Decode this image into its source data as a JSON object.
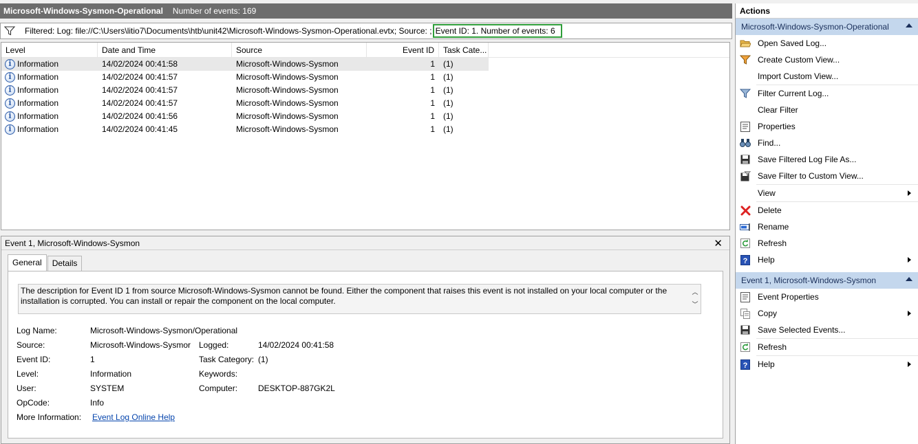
{
  "title_bar": {
    "log_name": "Microsoft-Windows-Sysmon-Operational",
    "event_count": "Number of events: 169"
  },
  "filter_bar": {
    "prefix": "Filtered: Log: file://C:\\Users\\litio7\\Documents\\htb\\unit42\\Microsoft-Windows-Sysmon-Operational.evtx; Source: ;",
    "highlight": "Event ID: 1. Number of events: 6"
  },
  "grid": {
    "columns": [
      "Level",
      "Date and Time",
      "Source",
      "Event ID",
      "Task Cate..."
    ],
    "rows": [
      {
        "level": "Information",
        "date": "14/02/2024 00:41:58",
        "source": "Microsoft-Windows-Sysmon",
        "event_id": "1",
        "task": "(1)"
      },
      {
        "level": "Information",
        "date": "14/02/2024 00:41:57",
        "source": "Microsoft-Windows-Sysmon",
        "event_id": "1",
        "task": "(1)"
      },
      {
        "level": "Information",
        "date": "14/02/2024 00:41:57",
        "source": "Microsoft-Windows-Sysmon",
        "event_id": "1",
        "task": "(1)"
      },
      {
        "level": "Information",
        "date": "14/02/2024 00:41:57",
        "source": "Microsoft-Windows-Sysmon",
        "event_id": "1",
        "task": "(1)"
      },
      {
        "level": "Information",
        "date": "14/02/2024 00:41:56",
        "source": "Microsoft-Windows-Sysmon",
        "event_id": "1",
        "task": "(1)"
      },
      {
        "level": "Information",
        "date": "14/02/2024 00:41:45",
        "source": "Microsoft-Windows-Sysmon",
        "event_id": "1",
        "task": "(1)"
      }
    ]
  },
  "detail": {
    "header": "Event 1, Microsoft-Windows-Sysmon",
    "tabs": [
      "General",
      "Details"
    ],
    "description": "The description for Event ID 1 from source Microsoft-Windows-Sysmon cannot be found. Either the component that raises this event is not installed on your local computer or the installation is corrupted. You can install or repair the component on the local computer.",
    "fields": {
      "log_name_label": "Log Name:",
      "log_name": "Microsoft-Windows-Sysmon/Operational",
      "source_label": "Source:",
      "source": "Microsoft-Windows-Sysmor",
      "logged_label": "Logged:",
      "logged": "14/02/2024 00:41:58",
      "event_id_label": "Event ID:",
      "event_id": "1",
      "task_category_label": "Task Category:",
      "task_category": "(1)",
      "level_label": "Level:",
      "level": "Information",
      "keywords_label": "Keywords:",
      "keywords": "",
      "user_label": "User:",
      "user": "SYSTEM",
      "computer_label": "Computer:",
      "computer": "DESKTOP-887GK2L",
      "opcode_label": "OpCode:",
      "opcode": "Info",
      "more_info_label": "More Information:",
      "more_info_link": "Event Log Online Help"
    }
  },
  "actions": {
    "title": "Actions",
    "section1": {
      "header": "Microsoft-Windows-Sysmon-Operational",
      "items": [
        {
          "label": "Open Saved Log...",
          "icon": "folder-open-icon"
        },
        {
          "label": "Create Custom View...",
          "icon": "filter-star-icon"
        },
        {
          "label": "Import Custom View...",
          "icon": ""
        },
        {
          "label": "Filter Current Log...",
          "icon": "filter-icon"
        },
        {
          "label": "Clear Filter",
          "icon": ""
        },
        {
          "label": "Properties",
          "icon": "properties-icon"
        },
        {
          "label": "Find...",
          "icon": "binoculars-icon"
        },
        {
          "label": "Save Filtered Log File As...",
          "icon": "save-icon"
        },
        {
          "label": "Save Filter to Custom View...",
          "icon": "save-filter-icon"
        },
        {
          "label": "View",
          "icon": ""
        },
        {
          "label": "Delete",
          "icon": "delete-icon"
        },
        {
          "label": "Rename",
          "icon": "rename-icon"
        },
        {
          "label": "Refresh",
          "icon": "refresh-icon"
        },
        {
          "label": "Help",
          "icon": "help-icon"
        }
      ]
    },
    "section2": {
      "header": "Event 1, Microsoft-Windows-Sysmon",
      "items": [
        {
          "label": "Event Properties",
          "icon": "properties-icon"
        },
        {
          "label": "Copy",
          "icon": "copy-icon"
        },
        {
          "label": "Save Selected Events...",
          "icon": "save-icon"
        },
        {
          "label": "Refresh",
          "icon": "refresh-icon"
        },
        {
          "label": "Help",
          "icon": "help-icon"
        }
      ]
    }
  },
  "colors": {
    "highlight_border": "#2f9e3a",
    "section_header_bg": "#c4d7ed",
    "title_bar_bg": "#6d6d6d",
    "link": "#0645ad"
  }
}
